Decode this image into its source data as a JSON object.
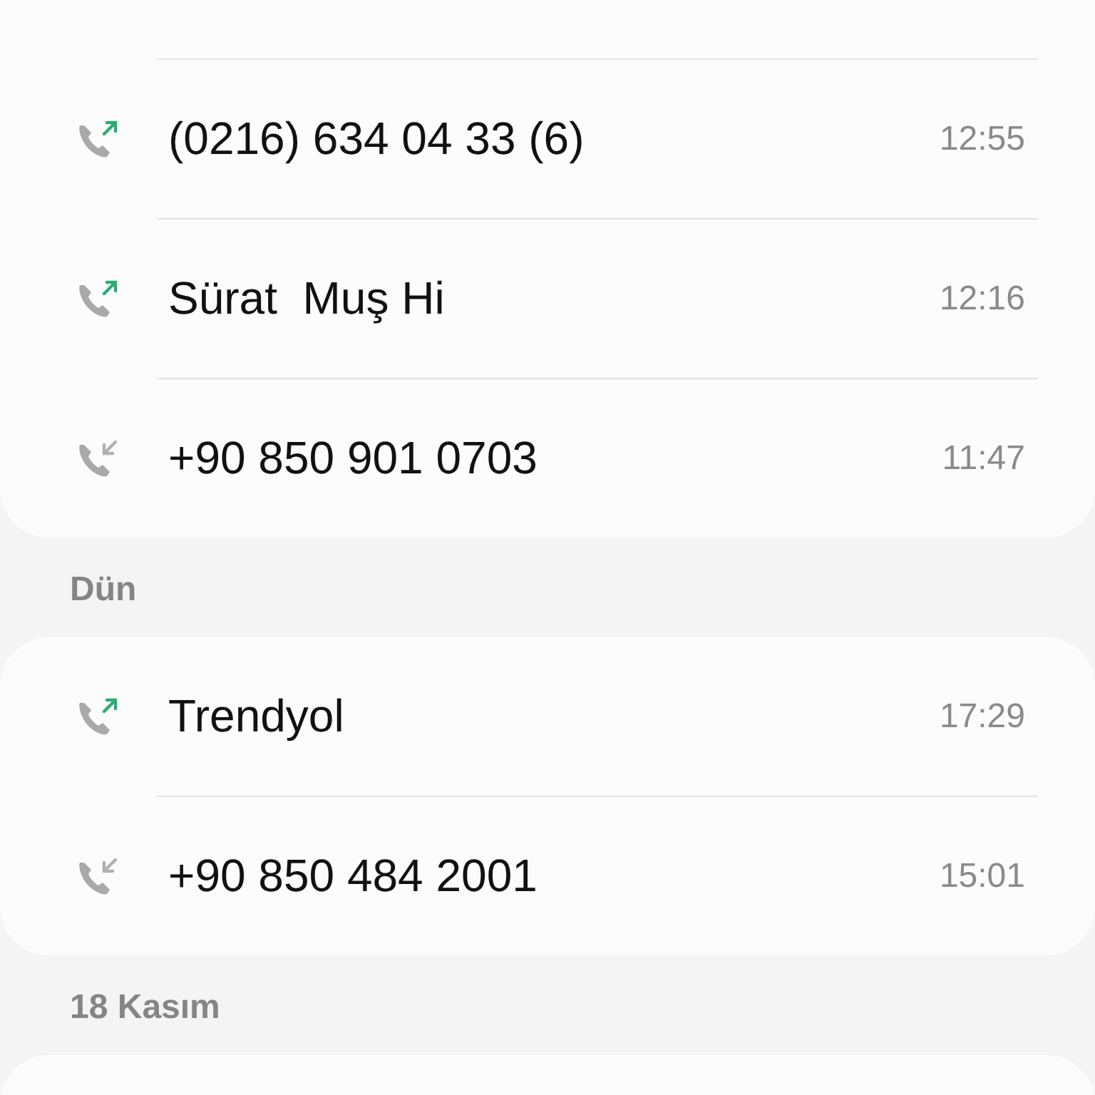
{
  "groups": [
    {
      "calls": [
        {
          "name": "(0216) 634 04 33 (6)",
          "time": "12:55",
          "kind": "outgoing"
        },
        {
          "name": "Sürat  Muş Hi",
          "time": "12:16",
          "kind": "outgoing"
        },
        {
          "name": "+90 850 901 0703",
          "time": "11:47",
          "kind": "incoming"
        }
      ]
    },
    {
      "header": "Dün",
      "calls": [
        {
          "name": "Trendyol",
          "time": "17:29",
          "kind": "outgoing"
        },
        {
          "name": "+90 850 484 2001",
          "time": "15:01",
          "kind": "incoming"
        }
      ]
    },
    {
      "header": "18 Kasım"
    }
  ]
}
